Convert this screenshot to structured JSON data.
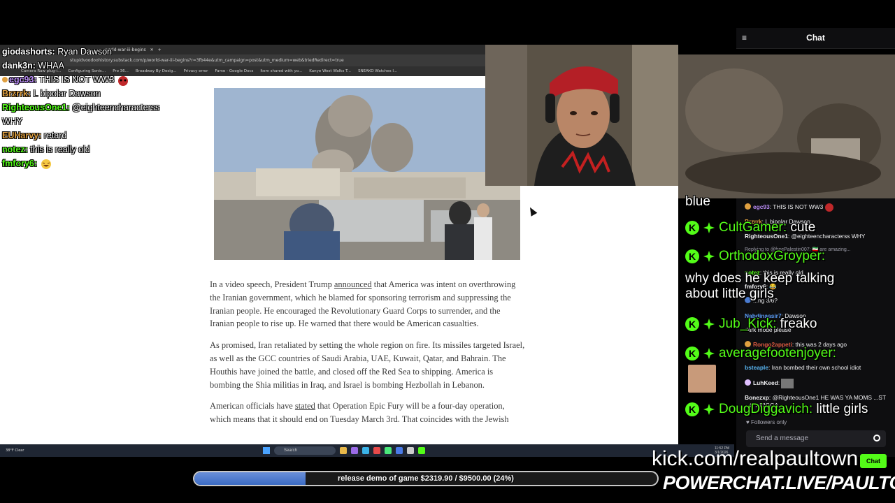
{
  "browser": {
    "tab_label": "world-war-iii-begins",
    "url": "stupidvoodoohistory.substack.com/p/world-war-iii-begins?r=3fb44e&utm_campaign=post&utm_medium=web&triedRedirect=true",
    "bookmarks": [
      "Camera Raw plug-i...",
      "Configuring Sonic...",
      "Pro 36...",
      "Broadway By Desig...",
      "Privacy error",
      "Fame - Google Docs",
      "Item shared with yo...",
      "Kanye West Walks T...",
      "SNEAKO Watches I..."
    ]
  },
  "article": {
    "paragraphs": [
      {
        "before": "In a video speech, President Trump ",
        "link": "announced",
        "after": " that America was intent on overthrowing the Iranian government, which he blamed for sponsoring terrorism and suppressing the Iranian people. He encouraged the Revolutionary Guard Corps to surrender, and the Iranian people to rise up. He warned that there would be American casualties."
      },
      {
        "before": "As promised, Iran retaliated by setting the whole region on fire. Its missiles targeted Israel, as well as the GCC countries of Saudi Arabia, UAE, Kuwait, Qatar, and Bahrain. The Houthis have joined the battle, and closed off the Red Sea to shipping. America is bombing the Shia militias in Iraq, and Israel is bombing Hezbollah in Lebanon.",
        "link": "",
        "after": ""
      },
      {
        "before": "American officials have ",
        "link": "stated",
        "after": " that Operation Epic Fury will be a four-day operation, which means that it should end on Tuesday March 3rd. That coincides with the Jewish"
      }
    ]
  },
  "taskbar": {
    "weather": "38°F Clear",
    "search_placeholder": "Search",
    "clock_time": "11:52 PM",
    "clock_date": "3/1/2026"
  },
  "overlay_chat": [
    {
      "user": "giodashorts:",
      "text": "Ryan Dawson",
      "user_color": "#ffffff"
    },
    {
      "user": "dank3n:",
      "text": "WHAA",
      "user_color": "#ffffff"
    },
    {
      "user": "egc93:",
      "text": "THIS IS NOT WW3",
      "user_color": "#b98cf5"
    },
    {
      "user": "Brzrrk:",
      "text": "L bipolar Dawson",
      "user_color": "#e0a040"
    },
    {
      "user": "RighteousOne1:",
      "text": "@eighteencharacterss",
      "user_color": "#53fc18"
    },
    {
      "user": "",
      "text": "WHY",
      "user_color": "#ffffff"
    },
    {
      "user": "EUHarvy:",
      "text": "retard",
      "user_color": "#e0a040"
    },
    {
      "user": "notez:",
      "text": "this is really old",
      "user_color": "#53fc18"
    },
    {
      "user": "fmfory6:",
      "text": "",
      "user_color": "#53fc18"
    }
  ],
  "chat_panel": {
    "title": "Chat",
    "messages": [
      {
        "user": "egc93",
        "text": "THIS IS NOT WW3",
        "user_color": "#b98cf5",
        "badge_color": "#e0a040"
      },
      {
        "user": "Brzrrk",
        "text": "L bipolar Dawson",
        "user_color": "#e0a040",
        "badge_color": ""
      },
      {
        "user": "RighteousOne1",
        "text": "@eighteencharacterss WHY",
        "user_color": "#efeff1",
        "badge_color": ""
      },
      {
        "user": "",
        "text": "Replying to @freePalestin007: 🇮🇷 are amazing...",
        "user_color": "#9c9ca8",
        "badge_color": ""
      },
      {
        "user": "notez",
        "text": "this is really old",
        "user_color": "#53fc18",
        "badge_color": ""
      },
      {
        "user": "fmfory6",
        "text": "😂",
        "user_color": "#efeff1",
        "badge_color": ""
      },
      {
        "user": "",
        "text": "...ng 3/6?",
        "user_color": "#efeff1",
        "badge_color": "#4a7bd0"
      },
      {
        "user": "Nabdinaasir7",
        "text": "Dawson",
        "user_color": "#5a9bf5",
        "badge_color": ""
      },
      {
        "user": "",
        "text": "dark mode please",
        "user_color": "#efeff1",
        "badge_color": ""
      },
      {
        "user": "Rongo2appeti",
        "text": "this was 2 days ago",
        "user_color": "#e05a40",
        "badge_color": "#e0a040"
      },
      {
        "user": "bsteaple",
        "text": "Iran bombed their own school idiot",
        "user_color": "#5ab8f5",
        "badge_color": ""
      },
      {
        "user": "LuhKeed",
        "text": "",
        "user_color": "#efeff1",
        "badge_color": "#e0c0ff"
      },
      {
        "user": "Bonezxp",
        "text": "@RighteousOne1 HE WAS YA MOMS ...ST ...GY NIGGA",
        "user_color": "#efeff1",
        "badge_color": ""
      }
    ],
    "followers_only": "Followers only",
    "send_placeholder": "Send a message",
    "chat_button": "Chat"
  },
  "big_chat": [
    {
      "user": "",
      "text": "blue"
    },
    {
      "user": "CultGamer:",
      "text": "cute"
    },
    {
      "user": "OrthodoxGroyper:",
      "text": "why does he keep talking about little girls"
    },
    {
      "user": "Jub_Kick:",
      "text": "freako"
    },
    {
      "user": "averagefootenjoyer:",
      "text": ""
    },
    {
      "user": "DougDiggavich:",
      "text": "little girls"
    }
  ],
  "stream": {
    "kick_url": "kick.com/realpaultown",
    "powerchat": "POWERCHAT.LIVE/PAULTOWN",
    "goal_text": "release demo of game $2319.90 / $9500.00 (24%)",
    "goal_progress": 0.24
  },
  "colors": {
    "kick_green": "#53fc18",
    "chat_bg": "#0e0e10",
    "goal_fill": "#3b6bc4"
  }
}
